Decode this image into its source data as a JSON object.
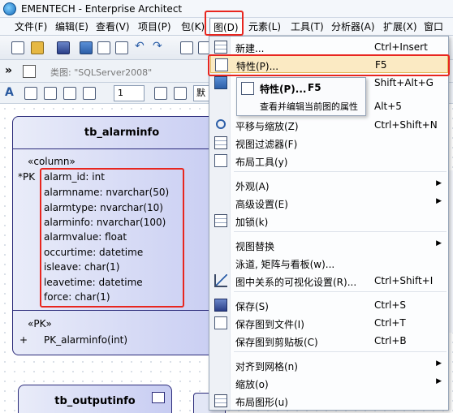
{
  "window": {
    "title": "EMENTECH - Enterprise Architect"
  },
  "menubar": {
    "items": [
      "文件(F)",
      "编辑(E)",
      "查看(V)",
      "项目(P)",
      "包(K)",
      "图(D)",
      "元素(L)",
      "工具(T)",
      "分析器(A)",
      "扩展(X)",
      "窗口(W)"
    ]
  },
  "toolbar2": {
    "type_label": "类图: \"SQLServer2008\""
  },
  "toolbar3": {
    "font_size": "1",
    "font_name": "默"
  },
  "class_box": {
    "name": "tb_alarminfo",
    "stereotype": "«column»",
    "pk_marker": "*PK",
    "attributes": [
      "alarm_id: int",
      "alarmname: nvarchar(50)",
      "alarmtype: nvarchar(10)",
      "alarminfo: nvarchar(100)",
      "alarmvalue: float",
      "occurtime: datetime",
      "isleave: char(1)",
      "leavetime: datetime",
      "force: char(1)"
    ],
    "op_stereotype": "«PK»",
    "op_marker": "+",
    "operation": "PK_alarminfo(int)"
  },
  "class_box2": {
    "name": "tb_outputinfo"
  },
  "menu": {
    "items": [
      {
        "label": "新建...",
        "shortcut": "Ctrl+Insert",
        "icon": "new-diagram-icon"
      },
      {
        "label": "特性(P)...",
        "shortcut": "F5",
        "icon": "properties-icon",
        "highlighted": true
      },
      {
        "label": "",
        "shortcut": "Shift+Alt+G",
        "icon": "layout-icon"
      },
      {
        "label": "",
        "shortcut": "Alt+5",
        "icon": ""
      },
      {
        "label": "平移与缩放(Z)",
        "shortcut": "Ctrl+Shift+N",
        "icon": "zoom-icon"
      },
      {
        "label": "视图过滤器(F)",
        "shortcut": "",
        "icon": "filter-icon"
      },
      {
        "label": "布局工具(y)",
        "shortcut": "",
        "icon": "layout-tools-icon"
      },
      {
        "label": "外观(A)",
        "shortcut": "",
        "submenu": true
      },
      {
        "label": "高级设置(E)",
        "shortcut": "",
        "submenu": true
      },
      {
        "label": "加锁(k)",
        "shortcut": "",
        "icon": "lock-icon"
      },
      {
        "label": "视图替换",
        "shortcut": "",
        "submenu": true
      },
      {
        "label": "泳道, 矩阵与看板(w)...",
        "shortcut": ""
      },
      {
        "label": "图中关系的可视化设置(R)...",
        "shortcut": "Ctrl+Shift+I",
        "icon": "relations-icon"
      },
      {
        "label": "保存(S)",
        "shortcut": "Ctrl+S",
        "icon": "save-icon"
      },
      {
        "label": "保存图到文件(I)",
        "shortcut": "Ctrl+T",
        "icon": "save-file-icon"
      },
      {
        "label": "保存图到剪贴板(C)",
        "shortcut": "Ctrl+B",
        "icon": "clipboard-icon"
      },
      {
        "label": "对齐到网格(n)",
        "shortcut": "",
        "submenu": true
      },
      {
        "label": "缩放(o)",
        "shortcut": "",
        "submenu": true
      },
      {
        "label": "布局图形(u)",
        "shortcut": "",
        "icon": "layout-diagram-icon"
      }
    ]
  },
  "submenu": {
    "title": "特性(P)...",
    "shortcut": "F5",
    "description": "查看并编辑当前图的属性"
  },
  "colors": {
    "highlight": "#fbeac3",
    "annotation_red": "#e8261f",
    "class_fill": "#c7ccf2"
  }
}
